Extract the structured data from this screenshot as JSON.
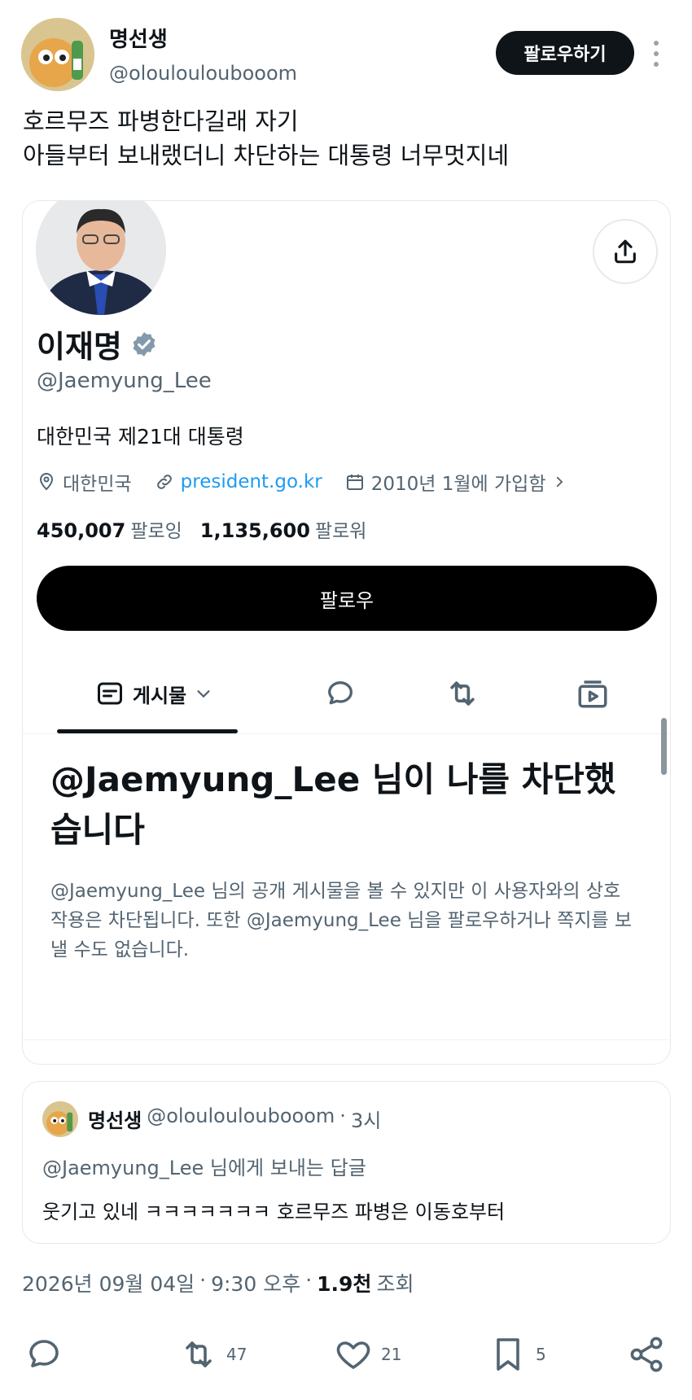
{
  "post": {
    "author_name": "명선생",
    "author_handle": "@oloulouloubooom",
    "follow_label": "팔로우하기",
    "text_line1": "호르무즈 파병한다길래 자기",
    "text_line2": "아들부터 보내랬더니 차단하는 대통령 너무멋지네"
  },
  "profile_card": {
    "name": "이재명",
    "handle": "@Jaemyung_Lee",
    "bio": "대한민국 제21대 대통령",
    "location": "대한민국",
    "website": "president.go.kr",
    "joined": "2010년 1월에 가입함",
    "following_count": "450,007",
    "following_label": "팔로잉",
    "followers_count": "1,135,600",
    "followers_label": "팔로워",
    "follow_button": "팔로우",
    "tabs": {
      "posts_label": "게시물"
    },
    "blocked_title": "@Jaemyung_Lee 님이 나를 차단했습니다",
    "blocked_desc": "@Jaemyung_Lee 님의 공개 게시물을 볼 수 있지만 이 사용자와의 상호작용은 차단됩니다. 또한 @Jaemyung_Lee 님을 팔로우하거나 쪽지를 보낼 수도 없습니다."
  },
  "reply": {
    "name": "명선생",
    "handle": "@oloulouloubooom",
    "separator": "·",
    "time": "3시",
    "replying_to": "@Jaemyung_Lee 님에게 보내는 답글",
    "text": "웃기고 있네 ㅋㅋㅋㅋㅋㅋㅋ 호르무즈 파병은 이동호부터"
  },
  "meta": {
    "date": "2026년 09월 04일",
    "dot1": "·",
    "time": "9:30 오후",
    "dot2": "·",
    "views": "1.9천",
    "views_label": "조회"
  },
  "actions": {
    "reply_count": "",
    "repost_count": "47",
    "like_count": "21",
    "bookmark_count": "5"
  },
  "colors": {
    "accent": "#1d9bf0",
    "verified": "#829aab",
    "button_dark": "#0f1419"
  }
}
